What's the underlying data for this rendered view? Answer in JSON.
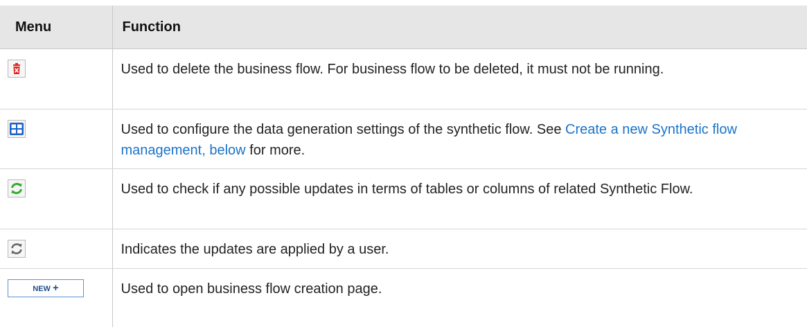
{
  "table": {
    "headers": {
      "menu": "Menu",
      "function": "Function"
    },
    "rows": [
      {
        "icon": "delete-icon",
        "text": "Used to delete the business flow. For business flow to be deleted, it must not be running."
      },
      {
        "icon": "grid-settings-icon",
        "text_before": "Used to configure the data generation settings of the synthetic flow. See ",
        "link": "Create a new Synthetic flow management, below",
        "text_after": " for more."
      },
      {
        "icon": "refresh-green-icon",
        "text": "Used to check if any possible updates in terms of tables or columns of related Synthetic Flow."
      },
      {
        "icon": "refresh-gray-icon",
        "text": "Indicates the updates are applied by a user."
      },
      {
        "icon": "new-button",
        "button_label": "NEW",
        "button_symbol": "+",
        "text": "Used to open business flow creation page."
      }
    ]
  },
  "colors": {
    "header_bg": "#e6e6e6",
    "link": "#1a73c8",
    "delete_red": "#e02020",
    "grid_blue": "#1a5fc8",
    "refresh_green": "#33aa33",
    "refresh_gray": "#666666"
  }
}
